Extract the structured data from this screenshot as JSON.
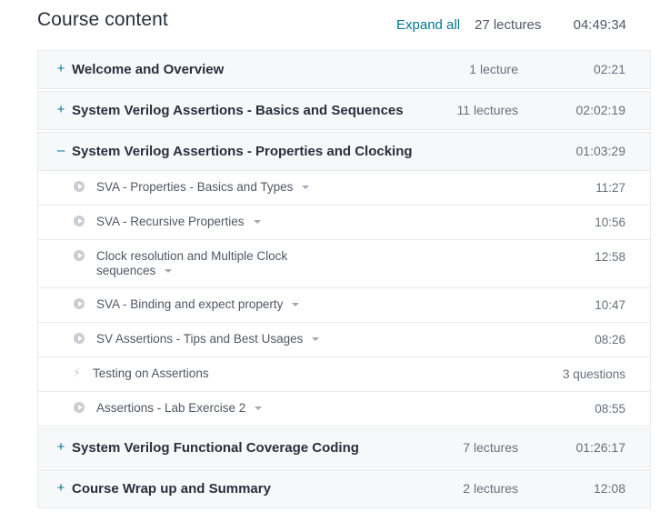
{
  "header": {
    "title": "Course content",
    "expand_all": "Expand all",
    "total_lectures": "27 lectures",
    "total_duration": "04:49:34"
  },
  "sections": [
    {
      "toggle": "+",
      "title": "Welcome and Overview",
      "count": "1 lecture",
      "duration": "02:21"
    },
    {
      "toggle": "+",
      "title": "System Verilog Assertions - Basics and Sequences",
      "count": "11 lectures",
      "duration": "02:02:19"
    },
    {
      "toggle": "–",
      "title": "System Verilog Assertions - Properties and Clocking",
      "count": "",
      "duration": "01:03:29"
    },
    {
      "toggle": "+",
      "title": "System Verilog Functional Coverage Coding",
      "count": "7 lectures",
      "duration": "01:26:17"
    },
    {
      "toggle": "+",
      "title": "Course Wrap up and Summary",
      "count": "2 lectures",
      "duration": "12:08"
    }
  ],
  "open_section_items": [
    {
      "title": "SVA - Properties - Basics and Types",
      "duration": "11:27",
      "icon": "play-circle-icon"
    },
    {
      "title": "SVA - Recursive Properties",
      "duration": "10:56",
      "icon": "play-circle-icon"
    },
    {
      "title_line1": "Clock resolution and Multiple Clock",
      "title_line2": "sequences",
      "duration": "12:58",
      "icon": "play-circle-icon"
    },
    {
      "title": "SVA - Binding and expect property",
      "duration": "10:47",
      "icon": "play-circle-icon"
    },
    {
      "title": "SV Assertions - Tips and Best Usages",
      "duration": "08:26",
      "icon": "play-circle-icon"
    },
    {
      "title": "Testing on Assertions",
      "duration": "3 questions",
      "icon": "lightning-icon"
    },
    {
      "title": "Assertions - Lab Exercise 2",
      "duration": "08:55",
      "icon": "play-circle-icon"
    }
  ],
  "colors": {
    "link": "#007791",
    "text": "#29303b",
    "muted": "#686f7a",
    "section_bg": "#f7f8fa",
    "border": "#e8e9eb",
    "icon": "#c9ccd0"
  }
}
